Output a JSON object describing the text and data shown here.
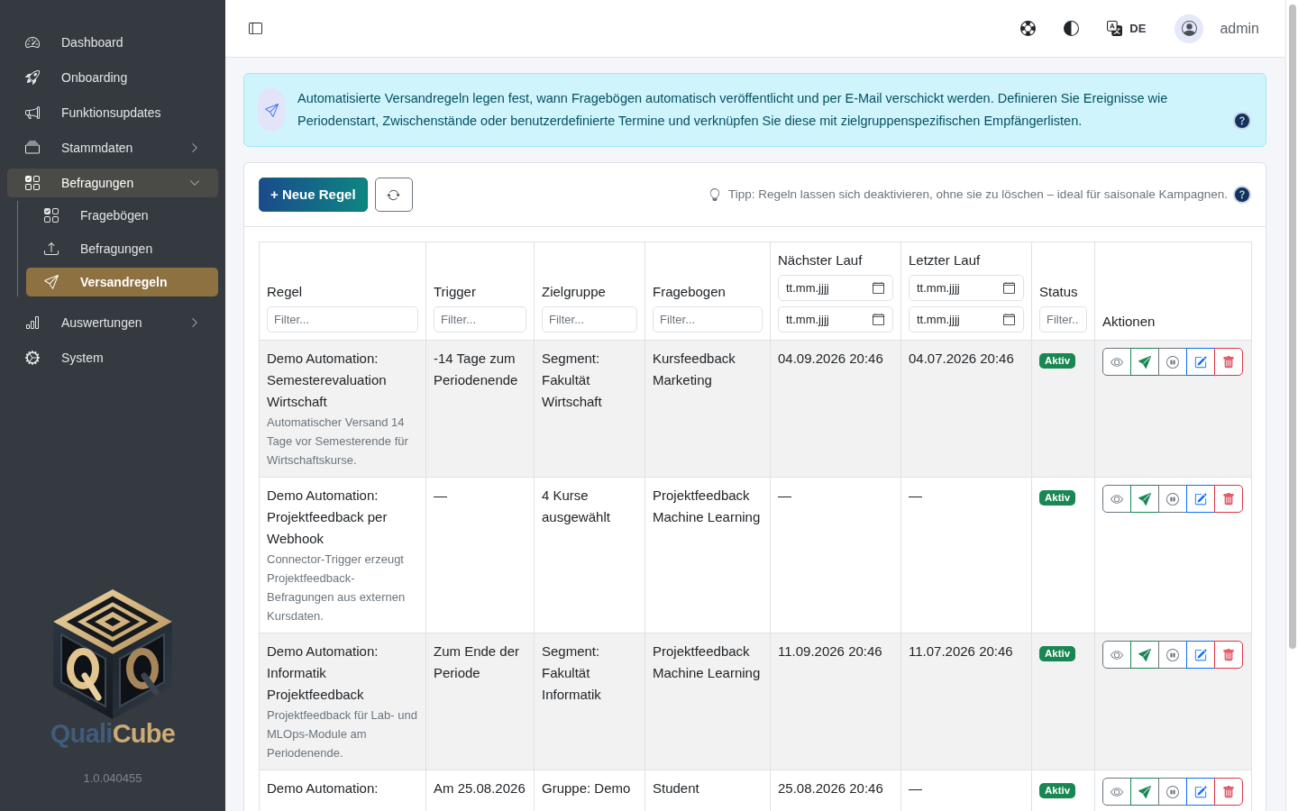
{
  "sidebar": {
    "items": [
      {
        "label": "Dashboard",
        "kind": "link",
        "selected": false
      },
      {
        "label": "Onboarding",
        "kind": "link",
        "selected": false
      },
      {
        "label": "Funktionsupdates",
        "kind": "link",
        "selected": false
      },
      {
        "label": "Stammdaten",
        "kind": "group",
        "expanded": false,
        "selected": false
      },
      {
        "label": "Befragungen",
        "kind": "group",
        "expanded": true,
        "selected": false,
        "children": [
          {
            "label": "Fragebögen",
            "selected": false
          },
          {
            "label": "Befragungen",
            "selected": false
          },
          {
            "label": "Versandregeln",
            "selected": true
          }
        ]
      },
      {
        "label": "Auswertungen",
        "kind": "group",
        "expanded": false,
        "selected": false
      },
      {
        "label": "System",
        "kind": "link",
        "selected": false
      }
    ],
    "wordmark": [
      "Quali",
      "Cube"
    ],
    "version": "1.0.040455"
  },
  "topbar": {
    "language": "DE",
    "user": "admin"
  },
  "banner": {
    "text": "Automatisierte Versandregeln legen fest, wann Fragebögen automatisch veröffentlicht und per E-Mail verschickt werden. Definieren Sie Ereignisse wie Periodenstart, Zwischenstände oder benutzerdefinierte Termine und verknüpfen Sie diese mit zielgruppenspezifischen Empfängerlisten."
  },
  "toolbar": {
    "new_button": "+ Neue Regel",
    "tip": "Tipp: Regeln lassen sich deaktivieren, ohne sie zu löschen – ideal für saisonale Kampagnen."
  },
  "table": {
    "columns": [
      {
        "label": "Regel",
        "filters": [
          {
            "kind": "text",
            "placeholder": "Filter..."
          }
        ]
      },
      {
        "label": "Trigger",
        "filters": [
          {
            "kind": "text",
            "placeholder": "Filter..."
          }
        ]
      },
      {
        "label": "Zielgruppe",
        "filters": [
          {
            "kind": "text",
            "placeholder": "Filter..."
          }
        ]
      },
      {
        "label": "Fragebogen",
        "filters": [
          {
            "kind": "text",
            "placeholder": "Filter..."
          }
        ]
      },
      {
        "label": "Nächster Lauf",
        "filters": [
          {
            "kind": "date",
            "placeholder": "tt.mm.jjjj"
          },
          {
            "kind": "date",
            "placeholder": "tt.mm.jjjj"
          }
        ]
      },
      {
        "label": "Letzter Lauf",
        "filters": [
          {
            "kind": "date",
            "placeholder": "tt.mm.jjjj"
          },
          {
            "kind": "date",
            "placeholder": "tt.mm.jjjj"
          }
        ]
      },
      {
        "label": "Status",
        "filters": [
          {
            "kind": "text",
            "placeholder": "Filter.."
          }
        ]
      },
      {
        "label": "Aktionen"
      }
    ],
    "row_actions": [
      {
        "kind": "view"
      },
      {
        "kind": "send"
      },
      {
        "kind": "pause"
      },
      {
        "kind": "edit"
      },
      {
        "kind": "delete"
      }
    ],
    "rows": [
      {
        "rule": "Demo Automation: Semesterevaluation Wirtschaft",
        "description": "Automatischer Versand 14 Tage vor Semesterende für Wirtschaftskurse.",
        "trigger": "-14 Tage zum Periodenende",
        "audience": "Segment: Fakultät Wirtschaft",
        "questionnaire": "Kursfeedback Marketing",
        "next_run": "04.09.2026 20:46",
        "last_run": "04.07.2026 20:46",
        "status": "Aktiv",
        "active": true
      },
      {
        "rule": "Demo Automation: Projektfeedback per Webhook",
        "description": "Connector-Trigger erzeugt Projektfeedback-Befragungen aus externen Kursdaten.",
        "trigger": "—",
        "audience": "4 Kurse ausgewählt",
        "questionnaire": "Projektfeedback Machine Learning",
        "next_run": "—",
        "last_run": "—",
        "status": "Aktiv",
        "active": true
      },
      {
        "rule": "Demo Automation: Informatik Projektfeedback",
        "description": "Projektfeedback für Lab- und MLOps-Module am Periodenende.",
        "trigger": "Zum Ende der Periode",
        "audience": "Segment: Fakultät Informatik",
        "questionnaire": "Projektfeedback Machine Learning",
        "next_run": "11.09.2026 20:46",
        "last_run": "11.07.2026 20:46",
        "status": "Aktiv",
        "active": true
      },
      {
        "rule": "Demo Automation:",
        "trigger": "Am 25.08.2026",
        "audience": "Gruppe: Demo",
        "questionnaire": "Student",
        "next_run": "25.08.2026 20:46",
        "last_run": "—",
        "status": "Aktiv",
        "active": true
      }
    ]
  }
}
